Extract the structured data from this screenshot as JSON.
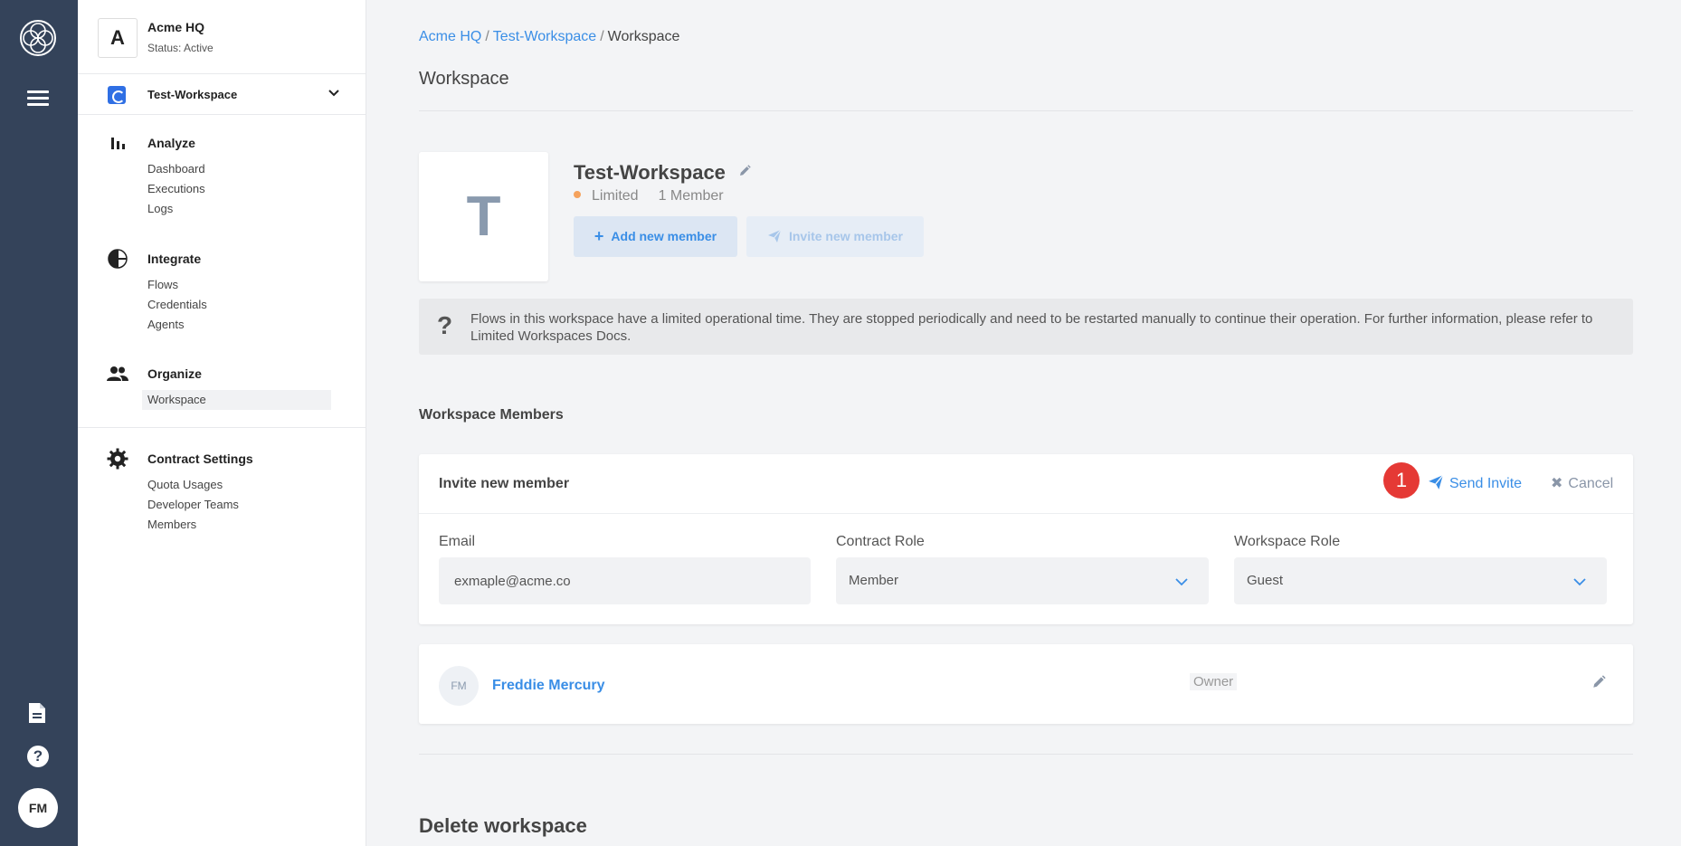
{
  "rail": {
    "avatar_initials": "FM"
  },
  "org": {
    "initial": "A",
    "name": "Acme HQ",
    "status": "Status: Active"
  },
  "workspace_selector": {
    "name": "Test-Workspace"
  },
  "sidebar": {
    "sections": [
      {
        "title": "Analyze",
        "icon": "bar-chart-icon",
        "items": [
          "Dashboard",
          "Executions",
          "Logs"
        ]
      },
      {
        "title": "Integrate",
        "icon": "pie-chart-icon",
        "items": [
          "Flows",
          "Credentials",
          "Agents"
        ]
      },
      {
        "title": "Organize",
        "icon": "people-icon",
        "items": [
          "Workspace"
        ]
      },
      {
        "title": "Contract Settings",
        "icon": "gear-icon",
        "items": [
          "Quota Usages",
          "Developer Teams",
          "Members"
        ]
      }
    ],
    "active_item": "Workspace"
  },
  "breadcrumb": {
    "items": [
      "Acme HQ",
      "Test-Workspace"
    ],
    "current": "Workspace"
  },
  "page": {
    "title": "Workspace"
  },
  "workspace": {
    "initial": "T",
    "name": "Test-Workspace",
    "type": "Limited",
    "member_count": "1 Member",
    "add_member_label": "Add new member",
    "invite_member_label": "Invite new member"
  },
  "notice": {
    "icon": "?",
    "text": "Flows in this workspace have a limited operational time. They are stopped periodically and need to be restarted manually to continue their operation. For further information, please refer to Limited Workspaces Docs."
  },
  "members_section": {
    "title": "Workspace Members"
  },
  "invite_form": {
    "title": "Invite new member",
    "step_badge": "1",
    "send_label": "Send Invite",
    "cancel_label": "Cancel",
    "email_label": "Email",
    "email_value": "exmaple@acme.co",
    "contract_role_label": "Contract Role",
    "contract_role_value": "Member",
    "workspace_role_label": "Workspace Role",
    "workspace_role_value": "Guest"
  },
  "members": [
    {
      "initials": "FM",
      "name": "Freddie Mercury",
      "role": "Owner"
    }
  ],
  "delete_section": {
    "title": "Delete workspace"
  },
  "colors": {
    "rail_bg": "#34435a",
    "accent": "#3a8ee6",
    "badge_red": "#e53935",
    "limited_dot": "#f5a25d"
  }
}
